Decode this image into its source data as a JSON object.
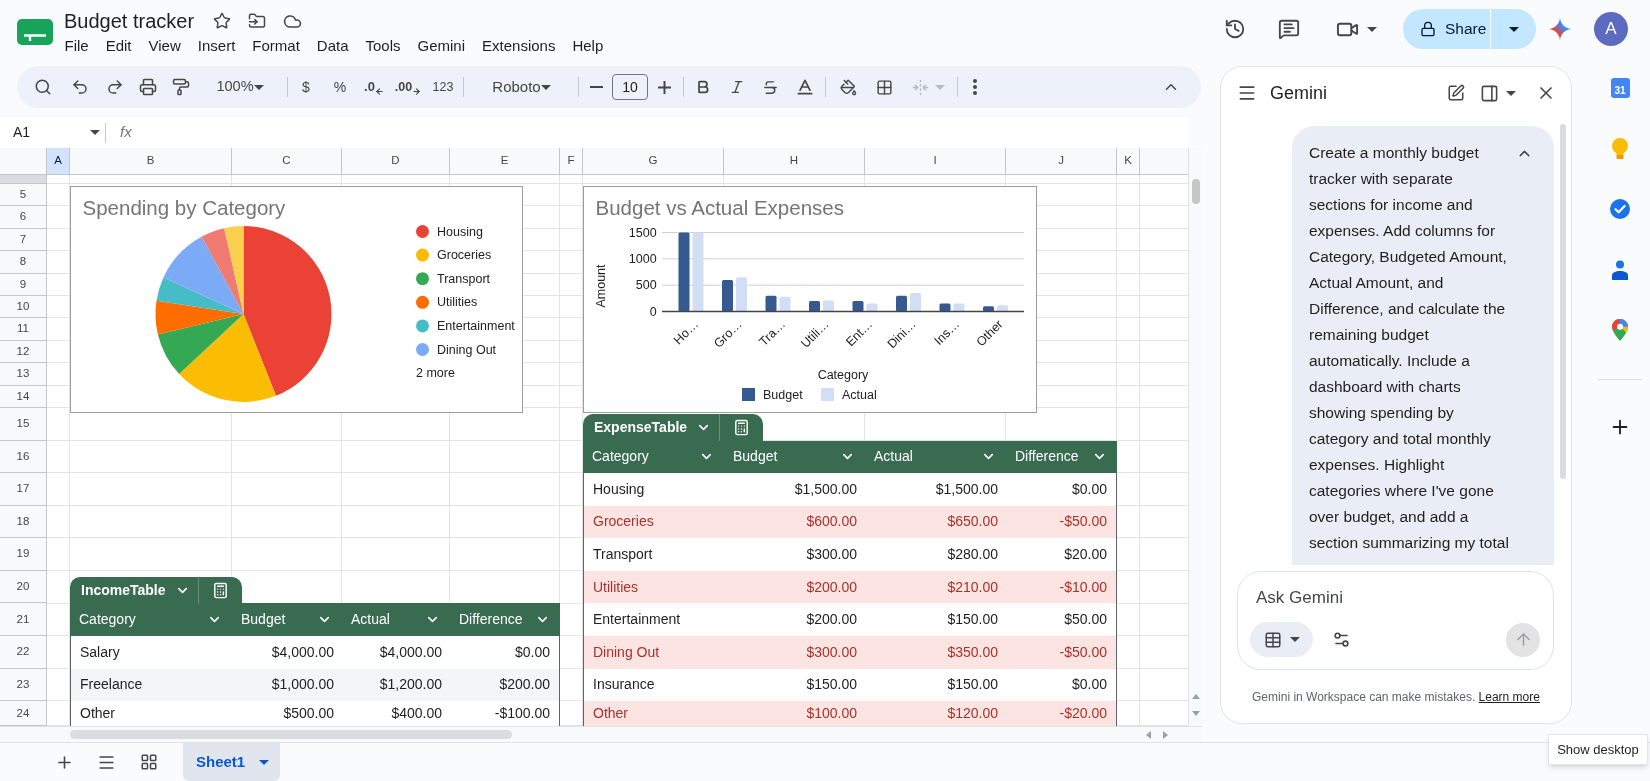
{
  "document": {
    "title": "Budget tracker",
    "menu": [
      "File",
      "Edit",
      "View",
      "Insert",
      "Format",
      "Data",
      "Tools",
      "Gemini",
      "Extensions",
      "Help"
    ]
  },
  "header_actions": {
    "share": "Share",
    "avatar": "A"
  },
  "toolbar": {
    "zoom": "100%",
    "currency": "$",
    "percent": "%",
    "decrease_decimal": ".0",
    "increase_decimal": ".00",
    "number_format": "123",
    "font": "Roboto",
    "font_size": "10",
    "merge": {
      "disabled": true
    }
  },
  "formula_bar": {
    "name_box": "A1",
    "fx": "fx"
  },
  "sheet": {
    "columns": [
      {
        "label": "A",
        "selected": true
      },
      {
        "label": "B",
        "selected": false
      },
      {
        "label": "C",
        "selected": false
      },
      {
        "label": "D",
        "selected": false
      },
      {
        "label": "E",
        "selected": false
      },
      {
        "label": "F",
        "selected": false
      },
      {
        "label": "G",
        "selected": false
      },
      {
        "label": "H",
        "selected": false
      },
      {
        "label": "I",
        "selected": false
      },
      {
        "label": "J",
        "selected": false
      },
      {
        "label": "K",
        "selected": false
      }
    ],
    "row_numbers": [
      "5",
      "6",
      "7",
      "8",
      "9",
      "10",
      "11",
      "12",
      "13",
      "14",
      "15",
      "16",
      "17",
      "18",
      "19",
      "20",
      "21",
      "22",
      "23",
      "24"
    ]
  },
  "pie_chart": {
    "chart_data": {
      "type": "pie",
      "title": "Spending by Category",
      "categories": [
        "Housing",
        "Groceries",
        "Transport",
        "Utilities",
        "Entertainment",
        "Dining Out",
        null,
        null
      ],
      "values": [
        43.99,
        19.06,
        8.21,
        6.16,
        4.4,
        10.26,
        4.4,
        3.52
      ],
      "colors": [
        "#ea4335",
        "#fbbc04",
        "#34a853",
        "#ff6d01",
        "#46bdc6",
        "#7baaf7",
        "#f07b72",
        "#fcd04f"
      ],
      "legend": "right"
    },
    "legend_more": "2 more"
  },
  "bar_chart": {
    "chart_data": {
      "type": "bar",
      "title": "Budget vs Actual Expenses",
      "xlabel": "Category",
      "ylabel": "Amount",
      "categories": [
        "Ho…",
        "Gro…",
        "Tra…",
        "Utili…",
        "Ent…",
        "Dini…",
        "Ins…",
        "Other"
      ],
      "series": [
        {
          "name": "Budget",
          "color": "#36598f",
          "values": [
            1500,
            600,
            300,
            200,
            200,
            300,
            150,
            100
          ]
        },
        {
          "name": "Actual",
          "color": "#d2def3",
          "values": [
            1500,
            650,
            280,
            210,
            150,
            350,
            150,
            120
          ]
        }
      ],
      "ylim": [
        0,
        1500
      ],
      "yticks": [
        0,
        500,
        1000,
        1500
      ],
      "legend": "bottom"
    }
  },
  "expense_table": {
    "name": "ExpenseTable",
    "columns": [
      "Category",
      "Budget",
      "Actual",
      "Difference"
    ],
    "rows": [
      {
        "cells": [
          "Housing",
          "$1,500.00",
          "$1,500.00",
          "$0.00"
        ],
        "over_budget": false
      },
      {
        "cells": [
          "Groceries",
          "$600.00",
          "$650.00",
          "-$50.00"
        ],
        "over_budget": true
      },
      {
        "cells": [
          "Transport",
          "$300.00",
          "$280.00",
          "$20.00"
        ],
        "over_budget": false
      },
      {
        "cells": [
          "Utilities",
          "$200.00",
          "$210.00",
          "-$10.00"
        ],
        "over_budget": true
      },
      {
        "cells": [
          "Entertainment",
          "$200.00",
          "$150.00",
          "$50.00"
        ],
        "over_budget": false
      },
      {
        "cells": [
          "Dining Out",
          "$300.00",
          "$350.00",
          "-$50.00"
        ],
        "over_budget": true
      },
      {
        "cells": [
          "Insurance",
          "$150.00",
          "$150.00",
          "$0.00"
        ],
        "over_budget": false
      },
      {
        "cells": [
          "Other",
          "$100.00",
          "$120.00",
          "-$20.00"
        ],
        "over_budget": true
      }
    ]
  },
  "income_table": {
    "name": "IncomeTable",
    "columns": [
      "Category",
      "Budget",
      "Actual",
      "Difference"
    ],
    "rows": [
      {
        "cells": [
          "Salary",
          "$4,000.00",
          "$4,000.00",
          "$0.00"
        ]
      },
      {
        "cells": [
          "Freelance",
          "$1,000.00",
          "$1,200.00",
          "$200.00"
        ]
      },
      {
        "cells": [
          "Other",
          "$500.00",
          "$400.00",
          "-$100.00"
        ]
      }
    ]
  },
  "sheet_tabs": [
    {
      "label": "Sheet1",
      "selected": true
    }
  ],
  "gemini": {
    "title": "Gemini",
    "prompt": "Create a monthly budget tracker with separate sections for income and expenses. Add columns for Category, Budgeted Amount, Actual Amount, and Difference, and calculate the remaining budget automatically. Include a dashboard with charts showing spending by category and total monthly expenses. Highlight categories where I've gone over budget, and add a section summarizing my total",
    "input": {
      "placeholder": "Ask Gemini"
    },
    "disclaimer": "Gemini in Workspace can make mistakes.",
    "link": "Learn more"
  },
  "side_apps": [
    {
      "kind": "calendar",
      "label": "31"
    },
    {
      "kind": "keep"
    },
    {
      "kind": "tasks"
    },
    {
      "kind": "contacts"
    },
    {
      "kind": "maps"
    }
  ],
  "tooltip": "Show desktop"
}
